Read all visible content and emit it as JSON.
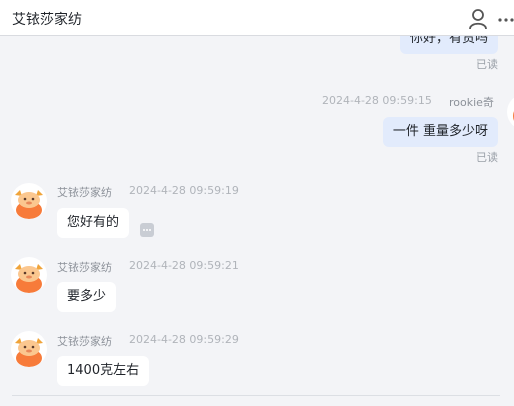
{
  "header": {
    "title": "艾铱莎家纺",
    "icons": [
      "person-icon",
      "more-icon"
    ]
  },
  "messages": {
    "top_partial": {
      "text": "你好，有货吗",
      "status": "已读"
    },
    "mine": {
      "time": "2024-4-28 09:59:15",
      "sender": "rookie奇",
      "text": "一件 重量多少呀",
      "status": "已读"
    },
    "seller": [
      {
        "name": "艾铱莎家纺",
        "time": "2024-4-28 09:59:19",
        "text": "您好有的"
      },
      {
        "name": "艾铱莎家纺",
        "time": "2024-4-28 09:59:21",
        "text": "要多少"
      },
      {
        "name": "艾铱莎家纺",
        "time": "2024-4-28 09:59:29",
        "text": "1400克左右"
      }
    ]
  },
  "colors": {
    "my_bubble": "#e2ebfc",
    "other_bubble": "#ffffff",
    "background": "#f3f4f7",
    "avatar_orange": "#f77b3a"
  }
}
